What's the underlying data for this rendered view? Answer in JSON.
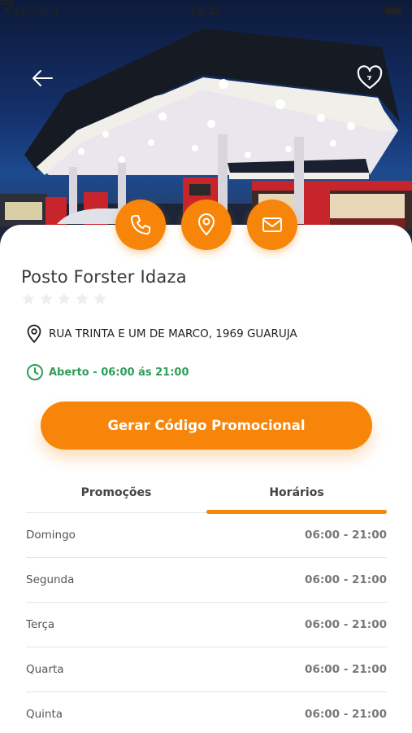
{
  "status_bar": {
    "carrier": "Operadora",
    "time": "09:32"
  },
  "hero": {
    "image": "gas-station-photo",
    "back_icon": "arrow-left-icon",
    "favorite_icon": "heart-icon"
  },
  "actions": [
    {
      "icon": "phone-icon"
    },
    {
      "icon": "map-pin-icon"
    },
    {
      "icon": "mail-icon"
    }
  ],
  "station": {
    "name": "Posto Forster Idaza",
    "rating": 0,
    "rating_max": 5,
    "address": "RUA TRINTA E UM DE MARCO, 1969 GUARUJA",
    "hours": "Aberto - 06:00 ás 21:00"
  },
  "promo_button": "Gerar Código Promocional",
  "tabs": [
    {
      "label": "Promoções",
      "active": false
    },
    {
      "label": "Horários",
      "active": true
    }
  ],
  "schedule": [
    {
      "day": "Domingo",
      "time": "06:00 - 21:00"
    },
    {
      "day": "Segunda",
      "time": "06:00 - 21:00"
    },
    {
      "day": "Terça",
      "time": "06:00 - 21:00"
    },
    {
      "day": "Quarta",
      "time": "06:00 - 21:00"
    },
    {
      "day": "Quinta",
      "time": "06:00 - 21:00"
    }
  ],
  "colors": {
    "accent": "#f7850a",
    "open_green": "#2e9e58",
    "star_empty": "#eeeeee"
  }
}
